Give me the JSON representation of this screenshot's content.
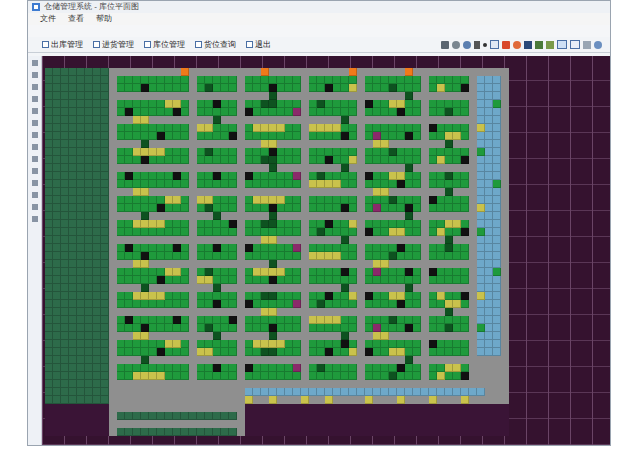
{
  "window": {
    "title": "仓储管理系统 - 库位平面图"
  },
  "menu": [
    "文件",
    "查看",
    "帮助"
  ],
  "toolbar": {
    "tabs": [
      {
        "label": "出库管理"
      },
      {
        "label": "进货管理"
      },
      {
        "label": "库位管理"
      },
      {
        "label": "货位查询"
      },
      {
        "label": "退出"
      }
    ]
  },
  "map": {
    "kinds": [
      {
        "code": "d",
        "color": "#2d6b4a"
      },
      {
        "code": "a",
        "color": "#8f8f8f"
      },
      {
        "code": "g",
        "color": "#1f9a3c"
      },
      {
        "code": "G",
        "color": "#0e5220"
      },
      {
        "code": "k",
        "color": "#111111"
      },
      {
        "code": "y",
        "color": "#c9c24c"
      },
      {
        "code": "b",
        "color": "#6ea8c9"
      },
      {
        "code": "o",
        "color": "#f07a1a"
      },
      {
        "code": "m",
        "color": "#8a2a6a"
      },
      {
        "code": "p",
        "color": "#3a1436"
      }
    ],
    "rows": [
      [
        "dddddddda",
        "aaaaaaaaoa",
        "aaaaaa",
        "aaoaaaaa",
        "aaaaaoa",
        "aaaaaoaa",
        "aaaaaa",
        "aaaa"
      ],
      [
        "dddddddda",
        "ggggggggga",
        "ggggga",
        "ggggggga",
        "gggggga",
        "ggggggga",
        "ggggga",
        "bbba"
      ],
      [
        "dddddddda",
        "gggkggggga",
        "gGggga",
        "gggkggga",
        "ggkggya",
        "gggGggga",
        "gyggka",
        "bbba"
      ],
      [
        "dddddddda",
        "aaaaaaaaaa",
        "aaaaaa",
        "aaaGaaaa",
        "aaaaaaa",
        "aaaaaGaa",
        "aaaaaa",
        "bbba"
      ],
      [
        "dddddddda",
        "ggggggyyga",
        "ggkgga",
        "ggGGggga",
        "gGgggga",
        "kggyygga",
        "ggggga",
        "bbga"
      ],
      [
        "dddddddda",
        "gkgggggkga",
        "ggggga",
        "kgggggma",
        "gggggga",
        "ggggkgga",
        "ggGgga",
        "bbba"
      ],
      [
        "dddddddda",
        "aayyaaaaaa",
        "aaGaaa",
        "aaaaaaaa",
        "aaaaGaa",
        "aaaaaaaa",
        "aaaaaa",
        "bbba"
      ],
      [
        "dddddddda",
        "ggggggggga",
        "yyggga",
        "gyyyygga",
        "yyyygga",
        "ggggggga",
        "kgggga",
        "ybba"
      ],
      [
        "dddddddda",
        "gggggkggga",
        "ggggka",
        "ggggggga",
        "ggggkga",
        "gmgggkga",
        "ggyyga",
        "bbba"
      ],
      [
        "dddddddda",
        "aaaGaaaaaa",
        "aaaaaa",
        "aayyaaaa",
        "aaaaaaa",
        "ayyaaaaa",
        "aaGaaa",
        "bbba"
      ],
      [
        "dddddddda",
        "ggyyyyggga",
        "gGggga",
        "gggkggga",
        "gggggga",
        "gggGggga",
        "ggggga",
        "gbba"
      ],
      [
        "dddddddda",
        "gggkggggga",
        "ggggga",
        "ggGGggga",
        "ggkggya",
        "ggggggga",
        "gyggka",
        "bbba"
      ],
      [
        "dddddddda",
        "aaaaaaaaaa",
        "aaaaaa",
        "aaaGaaaa",
        "aaaaGaa",
        "aaaaaGaa",
        "aaaaaa",
        "bbba"
      ],
      [
        "dddddddda",
        "gkgggggkga",
        "ggkgga",
        "kgggggma",
        "gGgggga",
        "kggyygga",
        "ggGgga",
        "bbba"
      ],
      [
        "dddddddda",
        "ggggggggga",
        "ggggga",
        "ggggggga",
        "yyyygga",
        "ggggkgga",
        "ggggga",
        "bbga"
      ],
      [
        "dddddddda",
        "aayyaaaaaa",
        "aaaaaa",
        "aaaaaaaa",
        "aaaaaaa",
        "ayyaaaaa",
        "aaGaaa",
        "bbba"
      ],
      [
        "dddddddda",
        "ggggggyyga",
        "yyggga",
        "gyyyygga",
        "gggggga",
        "gggGggga",
        "kgggga",
        "bbba"
      ],
      [
        "dddddddda",
        "gggggkggga",
        "gGggga",
        "gggkggga",
        "ggggkga",
        "gmgggkga",
        "ggggga",
        "ybba"
      ],
      [
        "dddddddda",
        "aaaGaaaaaa",
        "aaGaaa",
        "aaaGaaaa",
        "aaaaaaa",
        "aaaaaGaa",
        "aaaaaa",
        "bbba"
      ],
      [
        "dddddddda",
        "ggyyyyggga",
        "ggggka",
        "ggGGggga",
        "ggkggya",
        "ggggggga",
        "ggyyga",
        "bbba"
      ],
      [
        "dddddddda",
        "ggggggggga",
        "ggggga",
        "ggggggga",
        "gGgggga",
        "kggyygga",
        "gyggka",
        "gbba"
      ],
      [
        "dddddddda",
        "aaaaaaaaaa",
        "aaaaaa",
        "aayyaaaa",
        "aaaaGaa",
        "aaaaaaaa",
        "aaGaaa",
        "bbba"
      ],
      [
        "dddddddda",
        "gkgggggkga",
        "ggkgga",
        "kgggggma",
        "gggggga",
        "ggggkgga",
        "ggGgga",
        "bbba"
      ],
      [
        "dddddddda",
        "gggkggggga",
        "ggggga",
        "ggggggga",
        "yyyygga",
        "gggGggga",
        "ggggga",
        "bbba"
      ],
      [
        "dddddddda",
        "aayyaaaaaa",
        "aaaaaa",
        "aaaGaaaa",
        "aaaaaaa",
        "ayyaaaaa",
        "aaaaaa",
        "bbba"
      ],
      [
        "dddddddda",
        "ggggggyyga",
        "gGggga",
        "gyyyygga",
        "ggggkga",
        "gmgggkga",
        "kgggga",
        "bbga"
      ],
      [
        "dddddddda",
        "gggggkggga",
        "yyggga",
        "gggkggga",
        "gggggga",
        "ggggggga",
        "ggggga",
        "bbba"
      ],
      [
        "dddddddda",
        "aaaGaaaaaa",
        "aaGaaa",
        "aaaaaaaa",
        "aaaaGaa",
        "aaaaaGaa",
        "aaaaaa",
        "bbba"
      ],
      [
        "dddddddda",
        "ggyyyyggga",
        "ggggga",
        "ggGGggga",
        "ggkggya",
        "kggyygga",
        "gyggka",
        "ybba"
      ],
      [
        "dddddddda",
        "ggggggggga",
        "ggkgga",
        "kgggggma",
        "gGgggga",
        "ggggkgga",
        "ggyyga",
        "bbba"
      ],
      [
        "dddddddda",
        "aaaaaaaaaa",
        "aaaaaa",
        "aayyaaaa",
        "aaaaaaa",
        "aaaaaaaa",
        "aaGaaa",
        "bbba"
      ],
      [
        "dddddddda",
        "gkgggggkga",
        "ggggka",
        "ggggggga",
        "yyyygga",
        "gggGggga",
        "ggggga",
        "bbba"
      ],
      [
        "dddddddda",
        "gggkggggga",
        "gGggga",
        "gggkggga",
        "gggggga",
        "gmgggkga",
        "ggGgga",
        "gbba"
      ],
      [
        "dddddddda",
        "aayyaaaaaa",
        "aaGaaa",
        "aaaGaaaa",
        "aaaaGaa",
        "ayyaaaaa",
        "aaaaaa",
        "bbba"
      ],
      [
        "dddddddda",
        "ggggggyyga",
        "ggggga",
        "gyyyygga",
        "ggggkga",
        "ggggggga",
        "kgggga",
        "bbba"
      ],
      [
        "dddddddda",
        "gggggkggga",
        "yyggga",
        "ggGGggga",
        "ggkggya",
        "kggyygga",
        "ggggga",
        "bbba"
      ],
      [
        "dddddddda",
        "aaaGaaaaaa",
        "aaaaaa",
        "aaaaaaaa",
        "aaaaaaa",
        "aaaaaGaa",
        "aaaaaa",
        "aaaa"
      ],
      [
        "dddddddda",
        "ggggggggga",
        "ggkgga",
        "kgggggma",
        "gGgggga",
        "ggggkgga",
        "ggyyga",
        "aaaa"
      ],
      [
        "dddddddda",
        "ggyyyyggga",
        "ggggga",
        "ggggggga",
        "gggggga",
        "gggGggga",
        "gyggka",
        "aaaa"
      ],
      [
        "dddddddda",
        "aaaaaaaaaa",
        "aaaaaa",
        "aaaaaaaa",
        "aaaaaaa",
        "aaaaaaaa",
        "aaaaaa",
        "aaaa"
      ],
      [
        "dddddddda",
        "aaaaaaaaaa",
        "aaaaaa",
        "bbbbbbbb",
        "bbbbbbb",
        "bbbbbbbb",
        "bbbbbb",
        "baaa"
      ],
      [
        "dddddddda",
        "aaaaaaaaaa",
        "aaaaaa",
        "yaayaaay",
        "aayaaaa",
        "yaaayaaa",
        "yaaaya",
        "aaaa"
      ],
      [
        "ppppppppa",
        "aaaaaaaaaa",
        "aaaaaa",
        "pppppppp",
        "ppppppp",
        "pppppppp",
        "pppppp",
        "pppp"
      ],
      [
        "ppppppppa",
        "dddddddddd",
        "ddddda",
        "pppppppp",
        "ppppppp",
        "pppppppp",
        "pppppp",
        "pppp"
      ],
      [
        "ppppppppa",
        "aaaaaaaaaa",
        "aaaaaa",
        "pppppppp",
        "ppppppp",
        "pppppppp",
        "pppppp",
        "pppp"
      ],
      [
        "ppppppppa",
        "dddddddddd",
        "ddddda",
        "pppppppp",
        "ppppppp",
        "pppppppp",
        "pppppp",
        "pppp"
      ]
    ]
  }
}
